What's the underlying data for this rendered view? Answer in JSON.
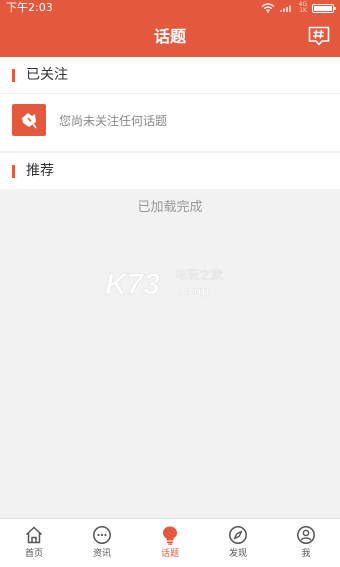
{
  "status": {
    "time": "下午2:03",
    "network_top": "4G",
    "network_bottom": "1K"
  },
  "header": {
    "title": "话题",
    "hash_icon": "topic-hash-icon"
  },
  "followed": {
    "section_label": "已关注",
    "empty_text": "您尚未关注任何话题",
    "icon": "leaf-icon"
  },
  "recommended": {
    "section_label": "推荐",
    "loaded_text": "已加载完成"
  },
  "watermark": {
    "logo_text": "K73",
    "site_text": "电玩之家",
    "domain_text": ".com"
  },
  "tabs": [
    {
      "label": "首页",
      "icon": "home-icon"
    },
    {
      "label": "资讯",
      "icon": "chat-icon"
    },
    {
      "label": "话题",
      "icon": "bulb-icon",
      "active": true
    },
    {
      "label": "发现",
      "icon": "compass-icon"
    },
    {
      "label": "我",
      "icon": "user-icon"
    }
  ],
  "colors": {
    "accent": "#e4583e",
    "background": "#f2f2f2"
  }
}
